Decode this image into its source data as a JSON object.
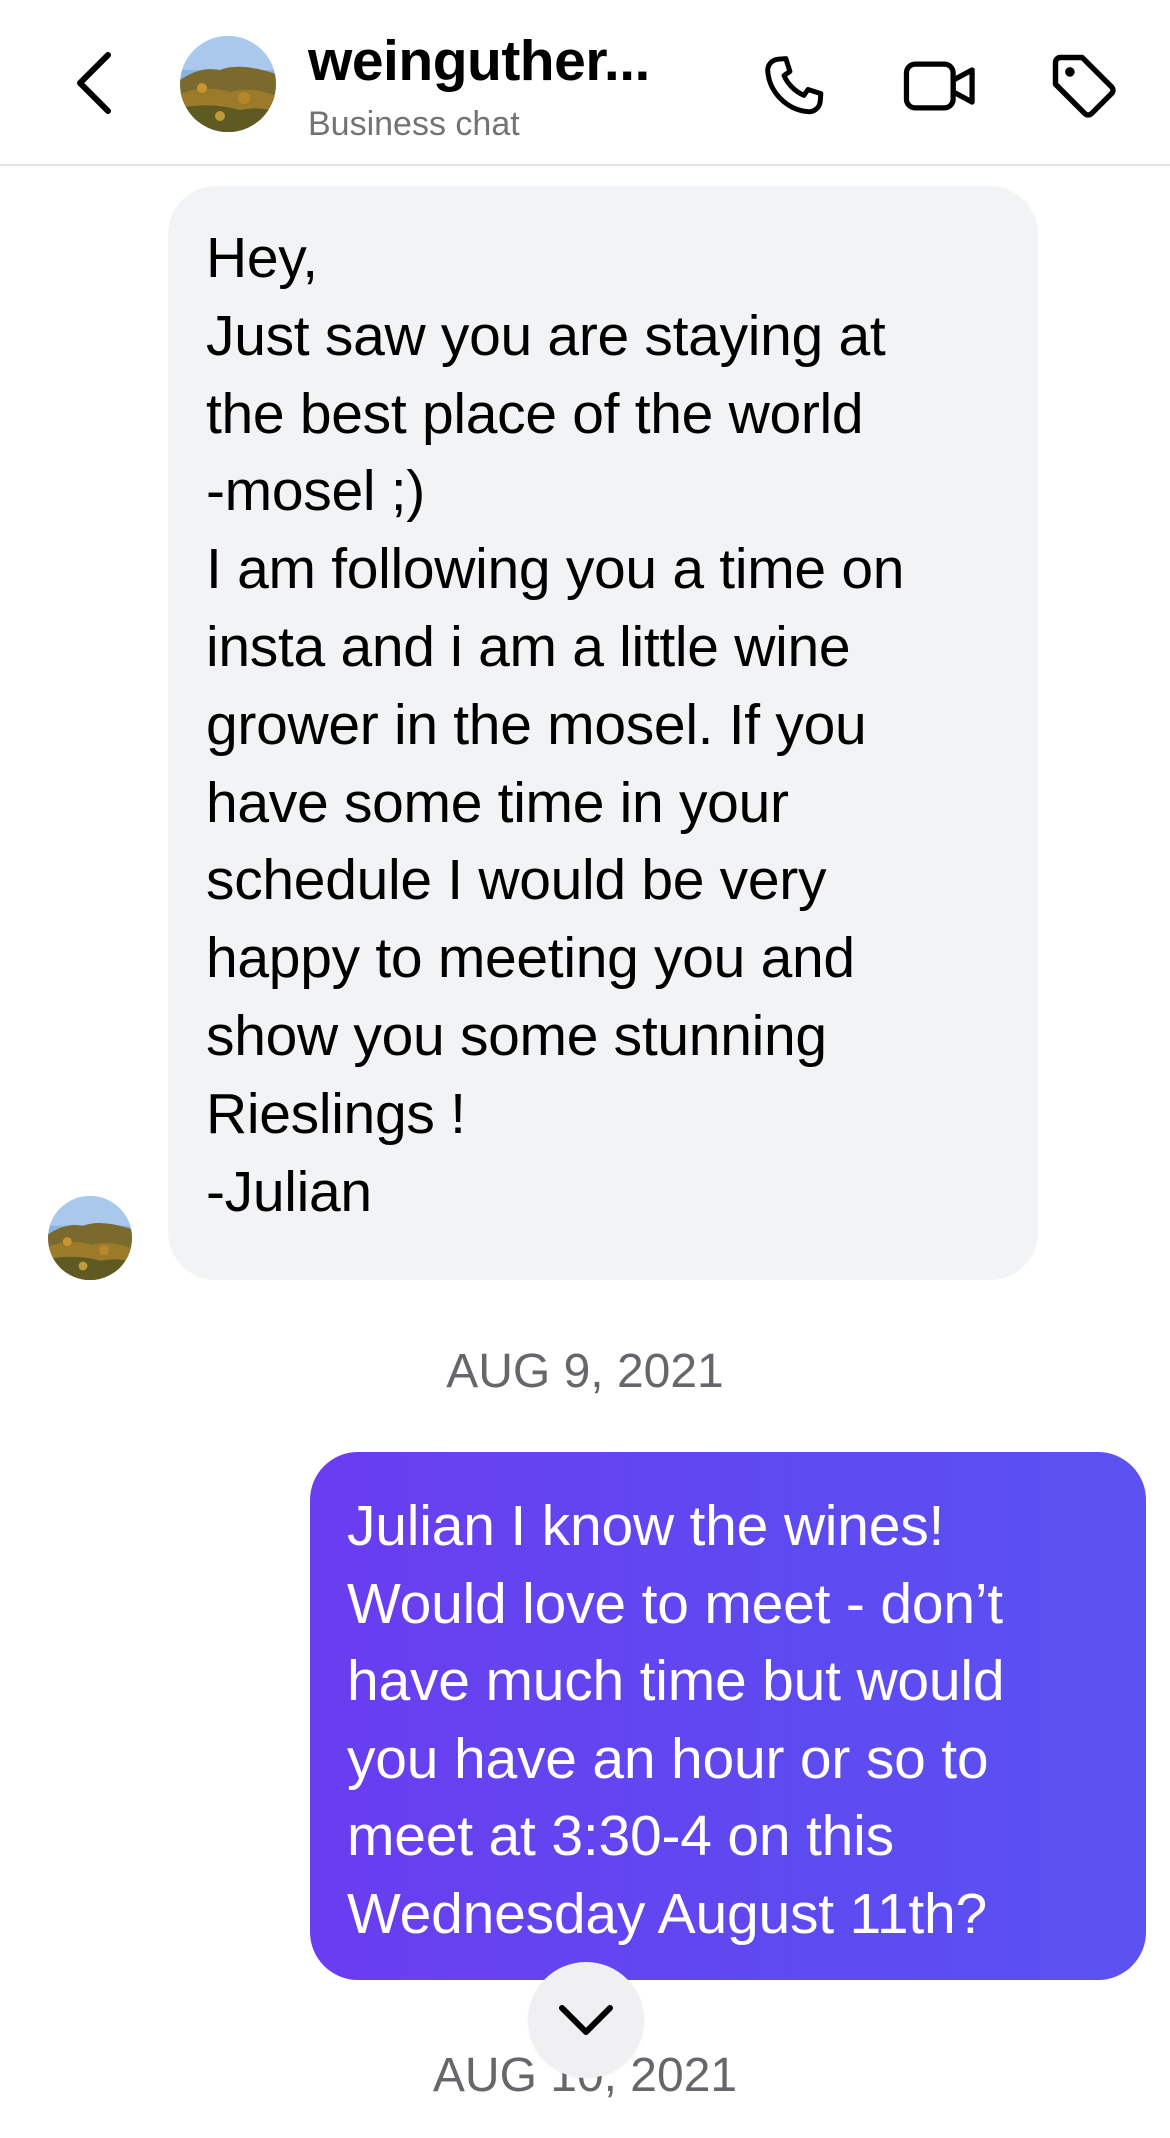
{
  "header": {
    "title": "weinguther...",
    "subtitle": "Business chat",
    "icons": [
      "chevron-left-icon",
      "phone-icon",
      "video-camera-icon",
      "tag-icon"
    ]
  },
  "messages": [
    {
      "direction": "incoming",
      "text": "Hey,\nJust saw you are staying at\nthe best place of the world\n-mosel ;)\nI am following you a time on\ninsta and i am a little wine\ngrower in the mosel. If you\nhave some time in your\nschedule I would be very\nhappy to meeting you and\nshow you some stunning\nRieslings !\n-Julian"
    },
    {
      "direction": "outgoing",
      "text": "Julian I know the wines!\nWould love to meet - don’t\nhave much time but would\nyou have an hour or so to\nmeet at 3:30-4 on this\nWednesday August 11th?"
    }
  ],
  "timestamps": [
    "AUG 9, 2021",
    "AUG 10, 2021"
  ],
  "colors": {
    "incoming_bubble": "#f2f3f5",
    "outgoing_bubble": "#5e4af1",
    "timestamp": "#65676b",
    "subtitle": "#737373"
  }
}
